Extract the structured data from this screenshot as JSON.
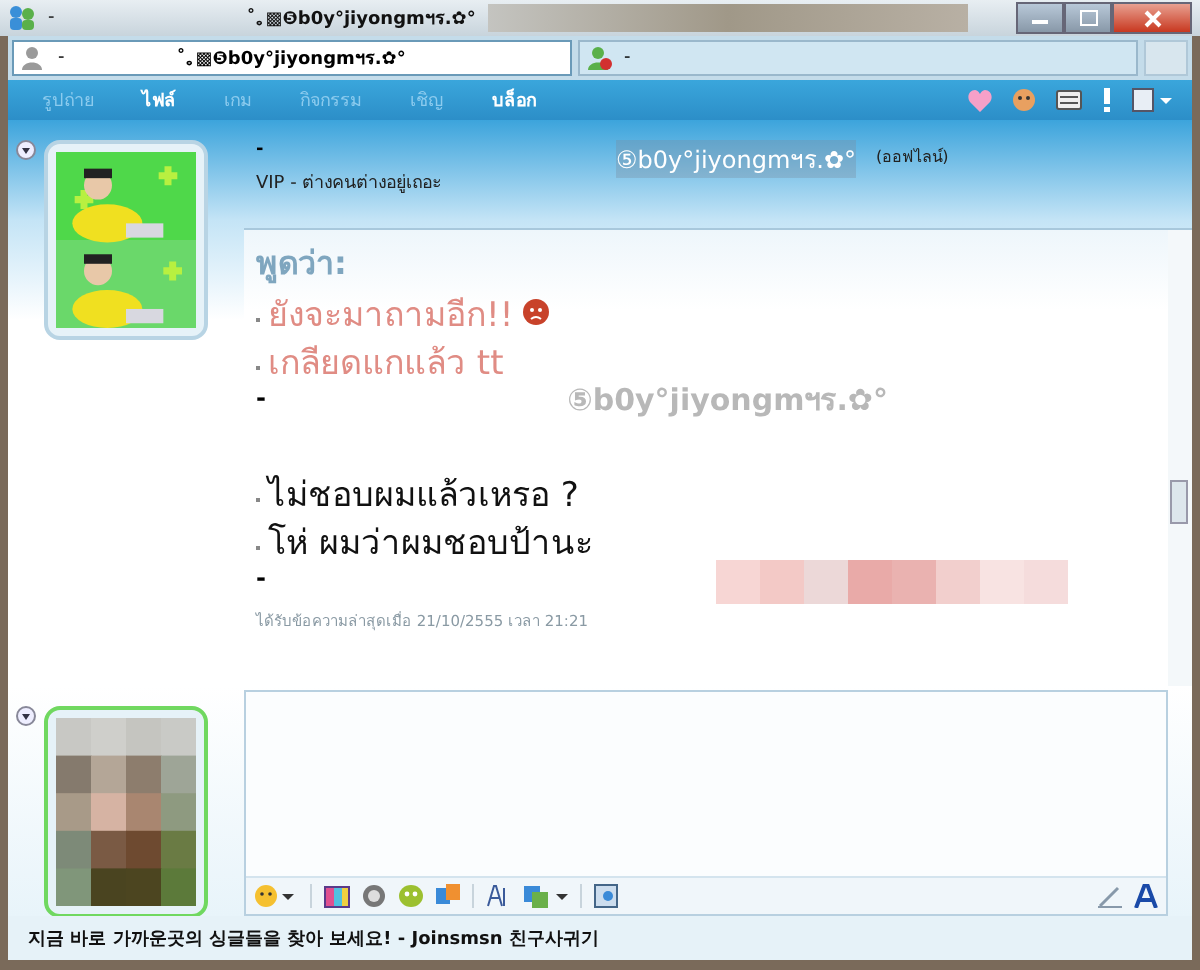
{
  "window": {
    "title_prefix": "-",
    "title": "˚｡▩❺b0y°jiyongmฯร.✿°"
  },
  "tabs": [
    {
      "prefix": "-",
      "label": "˚｡▩❺b0y°jiyongmฯร.✿°",
      "selected": true,
      "online": true
    },
    {
      "prefix": "-",
      "selected": false,
      "online": false
    }
  ],
  "menu": [
    {
      "label": "รูปถ่าย",
      "disabled": true
    },
    {
      "label": "ไฟล์",
      "disabled": false
    },
    {
      "label": "เกม",
      "disabled": true
    },
    {
      "label": "กิจกรรม",
      "disabled": true
    },
    {
      "label": "เชิญ",
      "disabled": true
    },
    {
      "label": "บล็อก",
      "disabled": false
    }
  ],
  "contact": {
    "name": "-",
    "message": "VIP - ต่างคนต่างอยู่เถอะ",
    "display_name": "⑤b0y°jiyongmฯร.✿°",
    "status": "(ออฟไลน์)"
  },
  "conversation": [
    {
      "sender": "พูดว่า:",
      "color": "#e08c84",
      "messages": [
        {
          "text": "ยังจะมาถามอีก!!",
          "emoticon": true
        },
        {
          "text": "เกลียดแกแล้ว tt",
          "emoticon": false
        }
      ],
      "end": "-"
    },
    {
      "sender": "⑤b0y°jiyongmฯร.✿°",
      "color": "#111111",
      "messages": [
        {
          "text": "ไม่ชอบผมแล้วเหรอ ?",
          "emoticon": false
        },
        {
          "text": "โห่ ผมว่าผมชอบป้านะ",
          "emoticon": false
        }
      ],
      "end": "-"
    }
  ],
  "last_received": "ได้รับข้อความล่าสุดเมื่อ 21/10/2555 เวลา 21:21",
  "ad": "지금 바로 가까운곳의 싱글들을 찾아 보세요! - Joinsmsn 친구사귀기"
}
